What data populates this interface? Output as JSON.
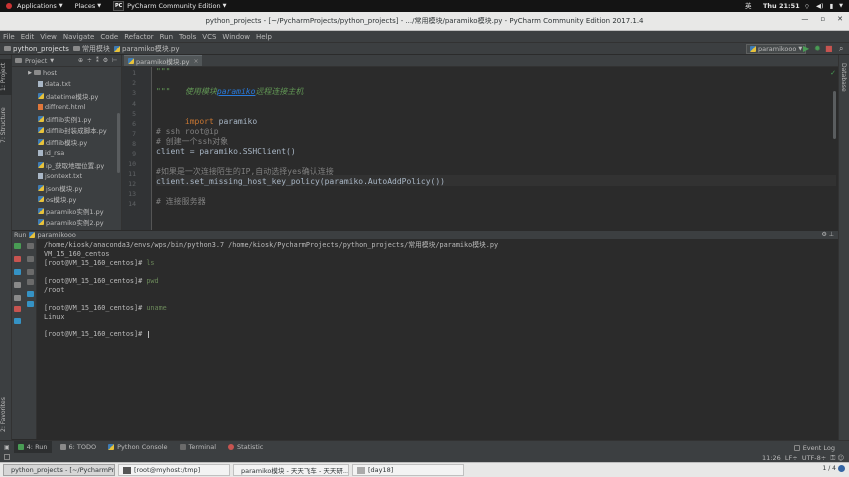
{
  "topbar": {
    "applications": "Applications",
    "places": "Places",
    "active_app": "PyCharm Community Edition",
    "input_method": "英",
    "clock": "Thu 21:51"
  },
  "window": {
    "title": "python_projects - [~/PycharmProjects/python_projects] - .../常用模块/paramiko模块.py - PyCharm Community Edition 2017.1.4"
  },
  "menubar": [
    "File",
    "Edit",
    "View",
    "Navigate",
    "Code",
    "Refactor",
    "Run",
    "Tools",
    "VCS",
    "Window",
    "Help"
  ],
  "breadcrumb": {
    "project": "python_projects",
    "folder": "常用模块",
    "file": "paramiko模块.py"
  },
  "run_config": "paramikooo",
  "tool_windows": {
    "project": "1: Project",
    "structure": "7: Structure",
    "favorites": "2: Favorites",
    "database": "Database"
  },
  "project_panel": {
    "title": "Project",
    "items": [
      {
        "name": "host",
        "type": "folder"
      },
      {
        "name": "data.txt",
        "type": "txt"
      },
      {
        "name": "datetime模块.py",
        "type": "py"
      },
      {
        "name": "diffrent.html",
        "type": "html"
      },
      {
        "name": "difflib实例1.py",
        "type": "py"
      },
      {
        "name": "difflib封装成脚本.py",
        "type": "py"
      },
      {
        "name": "difflib模块.py",
        "type": "py"
      },
      {
        "name": "id_rsa",
        "type": "txt"
      },
      {
        "name": "ip_获取地理位置.py",
        "type": "py"
      },
      {
        "name": "jsontext.txt",
        "type": "txt"
      },
      {
        "name": "json模块.py",
        "type": "py"
      },
      {
        "name": "os模块.py",
        "type": "py"
      },
      {
        "name": "paramiko实例1.py",
        "type": "py"
      },
      {
        "name": "paramiko实例2.py",
        "type": "py"
      }
    ]
  },
  "editor": {
    "tab": "paramiko模块.py",
    "line_numbers": [
      "1",
      "2",
      "3",
      "4",
      "5",
      "6",
      "7",
      "8",
      "9",
      "10",
      "11",
      "12",
      "13",
      "14"
    ],
    "lines": {
      "l1": "\"\"\"",
      "l2a": "使用模块",
      "l2b": "paramiko",
      "l2c": "远程连接主机",
      "l3": "\"\"\"",
      "l5a": "import",
      "l5b": " paramiko",
      "l7": "# ssh root@ip",
      "l8": "# 创建一个ssh对象",
      "l9": "client = paramiko.SSHClient()",
      "l11": "#如果是一次连接陌生的IP,自动选择yes确认连接",
      "l12": "client.set_missing_host_key_policy(paramiko.AutoAddPolicy())",
      "l14": "# 连接服务器"
    }
  },
  "run_panel": {
    "label": "Run",
    "config": "paramikooo",
    "console": {
      "cmdline": "/home/kiosk/anaconda3/envs/wps/bin/python3.7 /home/kiosk/PycharmProjects/python_projects/常用模块/paramiko模块.py",
      "host_out": "VM_15_160_centos",
      "prompt": "[root@VM_15_160_centos]# ",
      "cmd1": "ls",
      "cmd2": "pwd",
      "out2": "/root",
      "cmd3": "uname",
      "out3": "Linux"
    }
  },
  "bottom_tabs": {
    "run": "4: Run",
    "todo": "6: TODO",
    "python_console": "Python Console",
    "terminal": "Terminal",
    "statistic": "Statistic",
    "event_log": "Event Log"
  },
  "status": {
    "position": "11:26",
    "line_sep": "LF÷",
    "encoding": "UTF-8÷"
  },
  "taskbar": [
    "python_projects - [~/PycharmProj...",
    "[root@myhost:/tmp]",
    "paramiko模块 - 天天飞车 - 天天研...",
    "[day18]"
  ],
  "pager": "1 / 4"
}
